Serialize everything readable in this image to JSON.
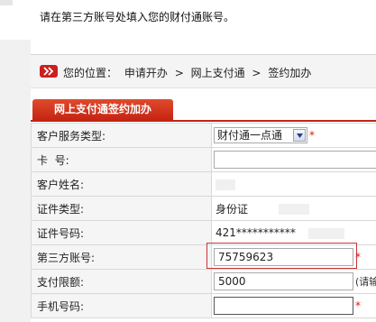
{
  "instruction": "请在第三方账号处填入您的财付通账号。",
  "breadcrumb": {
    "prefix": "您的位置：",
    "items": [
      "申请开办",
      "网上支付通",
      "签约加办"
    ],
    "separator": ">"
  },
  "tab": {
    "label": "网上支付通签约加办"
  },
  "form": {
    "service_type": {
      "label": "客户服务类型:",
      "selected": "财付通一点通"
    },
    "card_no": {
      "label": "卡  号:",
      "value": ""
    },
    "customer_name": {
      "label": "客户姓名:",
      "value": ""
    },
    "id_type": {
      "label": "证件类型:",
      "value": "身份证"
    },
    "id_no": {
      "label": "证件号码:",
      "value": "421***********"
    },
    "third_party_account": {
      "label": "第三方账号:",
      "value": "75759623"
    },
    "payment_limit": {
      "label": "支付限额:",
      "value": "5000",
      "hint": "(请输"
    },
    "mobile": {
      "label": "手机号码:",
      "value": ""
    }
  },
  "required_mark": "*",
  "colors": {
    "accent": "#c52512",
    "highlight_border": "#cc3333"
  }
}
